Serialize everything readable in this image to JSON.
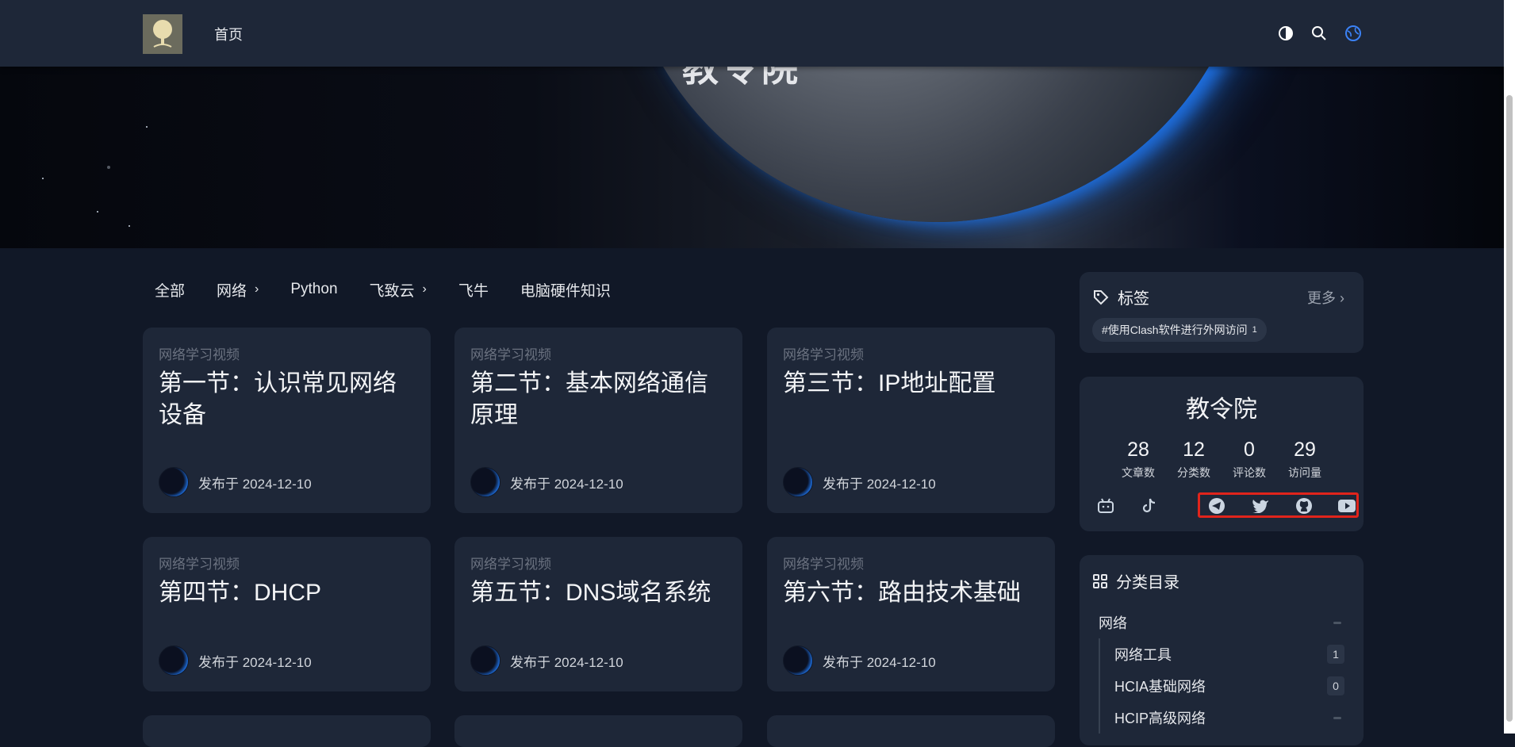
{
  "site": {
    "title_partial": "教令院"
  },
  "nav": {
    "home_label": "首页"
  },
  "category_tabs": [
    {
      "label": "全部",
      "has_chevron": false
    },
    {
      "label": "网络",
      "has_chevron": true
    },
    {
      "label": "Python",
      "has_chevron": false
    },
    {
      "label": "飞致云",
      "has_chevron": true
    },
    {
      "label": "飞牛",
      "has_chevron": false
    },
    {
      "label": "电脑硬件知识",
      "has_chevron": false
    }
  ],
  "posts": [
    {
      "category": "网络学习视频",
      "title": "第一节：认识常见网络设备",
      "meta": "发布于 2024-12-10"
    },
    {
      "category": "网络学习视频",
      "title": "第二节：基本网络通信原理",
      "meta": "发布于 2024-12-10"
    },
    {
      "category": "网络学习视频",
      "title": "第三节：IP地址配置",
      "meta": "发布于 2024-12-10"
    },
    {
      "category": "网络学习视频",
      "title": "第四节：DHCP",
      "meta": "发布于 2024-12-10"
    },
    {
      "category": "网络学习视频",
      "title": "第五节：DNS域名系统",
      "meta": "发布于 2024-12-10"
    },
    {
      "category": "网络学习视频",
      "title": "第六节：路由技术基础",
      "meta": "发布于 2024-12-10"
    }
  ],
  "tags_panel": {
    "title": "标签",
    "more_label": "更多",
    "tags": [
      {
        "label": "#使用Clash软件进行外网访问",
        "count": "1"
      }
    ]
  },
  "profile": {
    "name": "教令院",
    "stats": [
      {
        "value": "28",
        "label": "文章数"
      },
      {
        "value": "12",
        "label": "分类数"
      },
      {
        "value": "0",
        "label": "评论数"
      },
      {
        "value": "29",
        "label": "访问量"
      }
    ],
    "socials": [
      "bilibili-icon",
      "tiktok-icon",
      "telegram-icon",
      "twitter-icon",
      "github-icon",
      "youtube-icon"
    ]
  },
  "categories_panel": {
    "title": "分类目录",
    "parent": {
      "label": "网络"
    },
    "children": [
      {
        "label": "网络工具",
        "count": "1"
      },
      {
        "label": "HCIA基础网络",
        "count": "0"
      },
      {
        "label": "HCIP高级网络",
        "count": ""
      }
    ]
  },
  "colors": {
    "accent": "#1e6fe0",
    "highlight": "#e0241b",
    "card_bg": "#1e2738",
    "page_bg": "#111827"
  }
}
